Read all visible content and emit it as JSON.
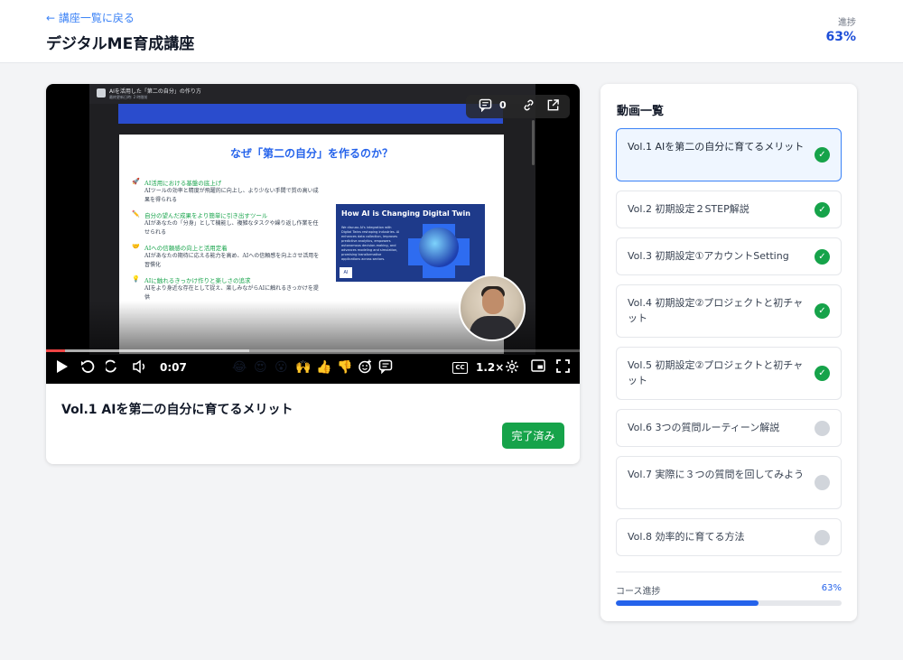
{
  "header": {
    "back_link": "← 講座一覧に戻る",
    "title": "デジタルME育成講座",
    "progress_label": "進捗",
    "progress_value": "63%"
  },
  "video": {
    "window_title": "AIを活用した「第二の自分」の作り方",
    "window_sub": "最終更新日時: 2 時間前",
    "slide_title": "なぜ「第二の自分」を作るのか？",
    "bullets": [
      {
        "icon": "🚀",
        "title": "AI活用における基盤の底上げ",
        "text": "AIツールの効率と精度が飛躍的に向上し、より少ない手間で質の高い成果を得られる"
      },
      {
        "icon": "✏️",
        "title": "自分の望んだ成果をより簡単に引き出すツール",
        "text": "AIがあなたの「分身」として機能し、複雑なタスクや繰り返し作業を任せられる"
      },
      {
        "icon": "🤝",
        "title": "AIへの信頼感の向上と活用定着",
        "text": "AIがあなたの期待に応える能力を高め、AIへの信頼感を向上させ活用を習慣化"
      },
      {
        "icon": "💡",
        "title": "AIに触れるきっかけ作りと楽しさの追求",
        "text": "AIをより身近な存在として捉え、楽しみながらAIに触れるきっかけを提供"
      }
    ],
    "thumb_title": "How AI is Changing Digital Twin",
    "thumb_text": "We discuss AI's integration with Digital Twins reshaping industries. AI enhances data collection, improves predictive analytics, empowers autonomous decision-making, and advances modeling and simulation, promising transformative applications across sectors.",
    "thumb_logo": "AI",
    "comment_count": "0",
    "time": "0:07",
    "speed": "1.2×",
    "cc": "CC",
    "progress_fraction": 0.035,
    "buffer_fraction": 0.38,
    "emojis": [
      "😂",
      "😍",
      "😮",
      "🙌",
      "👍",
      "👎"
    ]
  },
  "lesson_title": "Vol.1 AIを第二の自分に育てるメリット",
  "complete_button": "完了済み",
  "sidebar": {
    "title": "動画一覧",
    "lessons": [
      {
        "label": "Vol.1 AIを第二の自分に育てるメリット",
        "done": true,
        "active": true
      },
      {
        "label": "Vol.2 初期設定２STEP解説",
        "done": true
      },
      {
        "label": "Vol.3 初期設定①アカウントSetting",
        "done": true
      },
      {
        "label": "Vol.4 初期設定②プロジェクトと初チャット",
        "done": true
      },
      {
        "label": "Vol.5 初期設定②プロジェクトと初チャット",
        "done": true
      },
      {
        "label": "Vol.6 3つの質問ルーティーン解説",
        "done": false
      },
      {
        "label": "Vol.7 実際に３つの質問を回してみよう",
        "done": false
      },
      {
        "label": "Vol.8 効率的に育てる方法",
        "done": false
      }
    ],
    "course_label": "コース進捗",
    "course_value": "63%",
    "course_fraction": 0.63
  },
  "colors": {
    "accent": "#2563eb",
    "success": "#16a34a",
    "pending": "#d1d5db"
  }
}
